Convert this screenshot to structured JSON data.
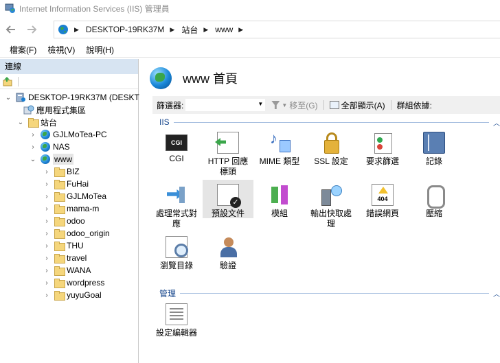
{
  "window": {
    "title": "Internet Information Services (IIS) 管理員"
  },
  "address": {
    "crumbs": [
      "DESKTOP-19RK37M",
      "站台",
      "www"
    ]
  },
  "menu": {
    "items": [
      "檔案(F)",
      "檢視(V)",
      "說明(H)"
    ]
  },
  "connections": {
    "header": "連線",
    "tree": [
      {
        "label": "DESKTOP-19RK37M (DESKT",
        "icon": "server-icon",
        "level": 0,
        "expanded": true
      },
      {
        "label": "應用程式集區",
        "icon": "app-pools-icon",
        "level": 1
      },
      {
        "label": "站台",
        "icon": "sites-folder-icon",
        "level": 1,
        "expanded": true
      },
      {
        "label": "GJLMoTea-PC",
        "icon": "globe-icon",
        "level": 2
      },
      {
        "label": "NAS",
        "icon": "globe-icon",
        "level": 2
      },
      {
        "label": "www",
        "icon": "globe-icon",
        "level": 2,
        "expanded": true,
        "selected": true
      },
      {
        "label": "BIZ",
        "icon": "folder-icon",
        "level": 3
      },
      {
        "label": "FuHai",
        "icon": "folder-icon",
        "level": 3
      },
      {
        "label": "GJLMoTea",
        "icon": "folder-icon",
        "level": 3
      },
      {
        "label": "mama-m",
        "icon": "folder-icon",
        "level": 3
      },
      {
        "label": "odoo",
        "icon": "folder-icon",
        "level": 3
      },
      {
        "label": "odoo_origin",
        "icon": "folder-icon",
        "level": 3
      },
      {
        "label": "THU",
        "icon": "folder-icon",
        "level": 3
      },
      {
        "label": "travel",
        "icon": "folder-icon",
        "level": 3
      },
      {
        "label": "WANA",
        "icon": "folder-icon",
        "level": 3
      },
      {
        "label": "wordpress",
        "icon": "folder-icon",
        "level": 3
      },
      {
        "label": "yuyuGoal",
        "icon": "folder-icon",
        "level": 3
      }
    ]
  },
  "content": {
    "title": "www 首頁",
    "filter": {
      "label": "篩選器:",
      "go_label": "移至(G)",
      "show_all_label": "全部顯示(A)",
      "group_by_label": "群組依據:"
    },
    "groups": {
      "iis": "IIS",
      "management": "管理"
    },
    "features": [
      {
        "label": "CGI",
        "icon": "cgi-icon"
      },
      {
        "label": "HTTP 回應標頭",
        "icon": "http-headers-icon"
      },
      {
        "label": "MIME 類型",
        "icon": "mime-types-icon"
      },
      {
        "label": "SSL 設定",
        "icon": "ssl-lock-icon"
      },
      {
        "label": "要求篩選",
        "icon": "request-filter-icon"
      },
      {
        "label": "記錄",
        "icon": "logging-icon"
      },
      {
        "label": "處理常式對應",
        "icon": "handler-mappings-icon"
      },
      {
        "label": "預設文件",
        "icon": "default-document-icon",
        "selected": true
      },
      {
        "label": "模組",
        "icon": "modules-icon"
      },
      {
        "label": "輸出快取處理",
        "icon": "output-cache-icon"
      },
      {
        "label": "錯誤網頁",
        "icon": "error-pages-icon"
      },
      {
        "label": "壓縮",
        "icon": "compression-icon"
      },
      {
        "label": "瀏覽目錄",
        "icon": "directory-browsing-icon"
      },
      {
        "label": "驗證",
        "icon": "authentication-icon"
      }
    ],
    "management_features": [
      {
        "label": "設定編輯器",
        "icon": "config-editor-icon"
      }
    ]
  }
}
